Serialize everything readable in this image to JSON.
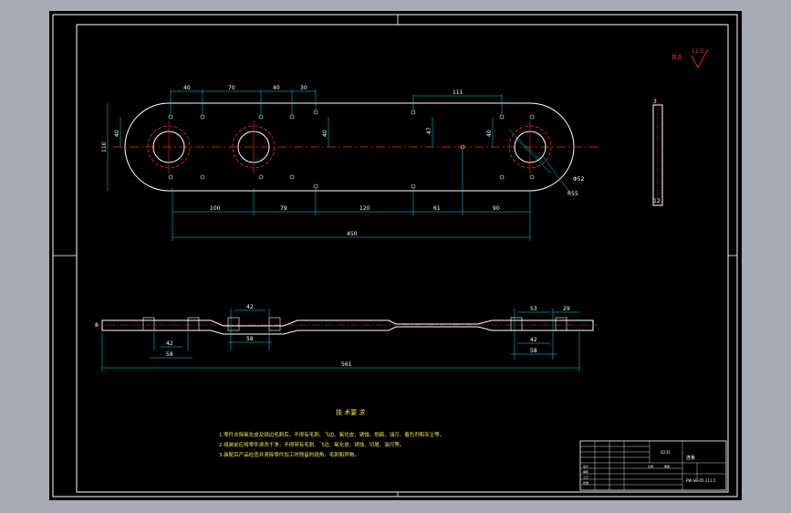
{
  "drawing": {
    "roughness_note": "其余",
    "roughness_value": "12.5",
    "dims_top": [
      "40",
      "70",
      "40",
      "30",
      "111"
    ],
    "dims_left": [
      "110",
      "40",
      "40"
    ],
    "dims_right": [
      "47",
      "40"
    ],
    "dims_bottom": [
      "100",
      "79",
      "120",
      "61",
      "90"
    ],
    "dim_total": "450",
    "dia_outer": "Φ52",
    "radius": "R55",
    "section_dims_top": [
      "42",
      "53",
      "29"
    ],
    "section_dims_bottom": [
      "42",
      "58",
      "42",
      "58",
      "42",
      "58"
    ],
    "section_total": "561",
    "section_left": "8",
    "side_dim_top": "3",
    "side_dim_bottom": "12"
  },
  "notes": {
    "title": "技 术要 求",
    "lines": [
      "1.零件去除氧化皮及锐边毛刺后，不得有毛刺、飞边、氧化皮、锈蚀、划痕、油污、着色剂和灰尘等。",
      "2.组装前应将零件清洗干净，不得带有毛刺、飞边、氧化皮、锈蚀、切屑、油污等。",
      "3.装配后产品检查并清除零件加工时残留的锐角、毛刺和异物。"
    ]
  },
  "title_block": {
    "part_name": "连板",
    "material": "Q235",
    "drawing_no": "PW-SB-05-11",
    "scale": "1:1",
    "small_labels": [
      "标记",
      "处数",
      "分区",
      "设计",
      "审核",
      "工艺",
      "批准",
      "比例",
      "重量"
    ]
  },
  "colors": {
    "background": "#000000",
    "outline": "#ffffff",
    "dimension": "#00e0e0",
    "center": "#ff2020",
    "note": "#e8e85a",
    "roughness": "#ff3030"
  }
}
